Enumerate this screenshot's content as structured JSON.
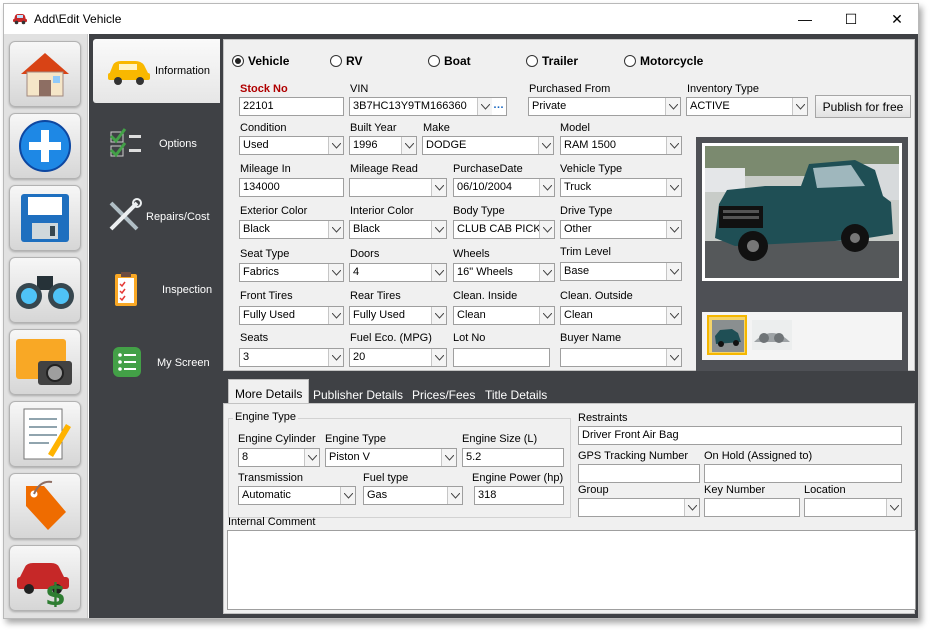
{
  "window": {
    "title": "Add\\Edit Vehicle",
    "minimize": "—",
    "maximize": "☐",
    "close": "✕"
  },
  "leftbar": [
    "home-icon",
    "add-icon",
    "save-icon",
    "binoculars-icon",
    "camera-icon",
    "notepad-icon",
    "tag-icon",
    "car-dollar-icon"
  ],
  "nav": {
    "information": "Information",
    "options": "Options",
    "repairs": "Repairs/Cost",
    "inspection": "Inspection",
    "myscreen": "My Screen"
  },
  "vehicle_types": [
    "Vehicle",
    "RV",
    "Boat",
    "Trailer",
    "Motorcycle"
  ],
  "selected_type": "Vehicle",
  "form": {
    "stock_no": {
      "label": "Stock No",
      "value": "22101"
    },
    "vin": {
      "label": "VIN",
      "value": "3B7HC13Y9TM166360",
      "ellipsis": "…"
    },
    "purchased_from": {
      "label": "Purchased From",
      "value": "Private"
    },
    "inventory_type": {
      "label": "Inventory Type",
      "value": "ACTIVE"
    },
    "publish": "Publish for free",
    "condition": {
      "label": "Condition",
      "value": "Used"
    },
    "built_year": {
      "label": "Built Year",
      "value": "1996"
    },
    "make": {
      "label": "Make",
      "value": "DODGE"
    },
    "model": {
      "label": "Model",
      "value": "RAM 1500"
    },
    "mileage_in": {
      "label": "Mileage In",
      "value": "134000"
    },
    "mileage_read": {
      "label": "Mileage Read",
      "value": ""
    },
    "purchase_date": {
      "label": "PurchaseDate",
      "value": "06/10/2004"
    },
    "vehicle_type": {
      "label": "Vehicle Type",
      "value": "Truck"
    },
    "exterior_color": {
      "label": "Exterior Color",
      "value": "Black"
    },
    "interior_color": {
      "label": "Interior Color",
      "value": "Black"
    },
    "body_type": {
      "label": "Body Type",
      "value": "CLUB CAB PICKUP"
    },
    "drive_type": {
      "label": "Drive Type",
      "value": "Other"
    },
    "seat_type": {
      "label": "Seat Type",
      "value": "Fabrics"
    },
    "doors": {
      "label": "Doors",
      "value": "4"
    },
    "wheels": {
      "label": "Wheels",
      "value": "16\" Wheels"
    },
    "trim_level": {
      "label": "Trim Level",
      "value": "Base"
    },
    "front_tires": {
      "label": "Front Tires",
      "value": "Fully Used"
    },
    "rear_tires": {
      "label": "Rear Tires",
      "value": "Fully Used"
    },
    "clean_inside": {
      "label": "Clean. Inside",
      "value": "Clean"
    },
    "clean_outside": {
      "label": "Clean. Outside",
      "value": "Clean"
    },
    "seats": {
      "label": "Seats",
      "value": "3"
    },
    "fuel_eco": {
      "label": "Fuel Eco. (MPG)",
      "value": "20"
    },
    "lot_no": {
      "label": "Lot No",
      "value": ""
    },
    "buyer_name": {
      "label": "Buyer Name",
      "value": ""
    }
  },
  "lower_tabs": [
    "More Details",
    "Publisher Details",
    "Prices/Fees",
    "Title Details"
  ],
  "details": {
    "engine_type_group": "Engine Type",
    "engine_cylinder": {
      "label": "Engine Cylinder",
      "value": "8"
    },
    "engine_type": {
      "label": "Engine Type",
      "value": "Piston V"
    },
    "engine_size": {
      "label": "Engine Size (L)",
      "value": "5.2"
    },
    "transmission": {
      "label": "Transmission",
      "value": "Automatic"
    },
    "fuel_type": {
      "label": "Fuel type",
      "value": "Gas"
    },
    "engine_power": {
      "label": "Engine Power (hp)",
      "value": "318"
    },
    "restraints": {
      "label": "Restraints",
      "value": "Driver Front Air Bag"
    },
    "gps": {
      "label": "GPS Tracking Number",
      "value": ""
    },
    "on_hold": {
      "label": "On Hold (Assigned to)",
      "value": ""
    },
    "group": {
      "label": "Group",
      "value": ""
    },
    "key_number": {
      "label": "Key Number",
      "value": ""
    },
    "location": {
      "label": "Location",
      "value": ""
    },
    "internal_comment": {
      "label": "Internal Comment",
      "value": ""
    }
  },
  "colors": {
    "dark_panel": "#3f4145",
    "stock_label": "#b00000",
    "truck": "#1f4f55"
  }
}
